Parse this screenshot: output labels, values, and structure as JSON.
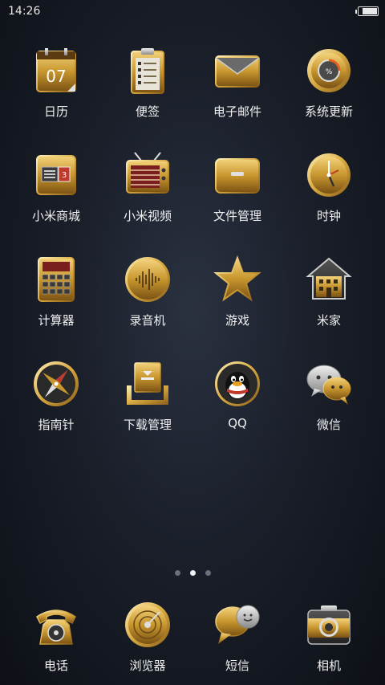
{
  "status": {
    "time": "14:26",
    "battery_level": 0.85
  },
  "apps": [
    {
      "label": "日历",
      "icon": "calendar-icon",
      "date": "07"
    },
    {
      "label": "便签",
      "icon": "notes-icon"
    },
    {
      "label": "电子邮件",
      "icon": "email-icon"
    },
    {
      "label": "系统更新",
      "icon": "system-update-icon"
    },
    {
      "label": "小米商城",
      "icon": "mi-store-icon",
      "badge": "3"
    },
    {
      "label": "小米视频",
      "icon": "tv-video-icon"
    },
    {
      "label": "文件管理",
      "icon": "file-manager-icon"
    },
    {
      "label": "时钟",
      "icon": "clock-icon"
    },
    {
      "label": "计算器",
      "icon": "calculator-icon"
    },
    {
      "label": "录音机",
      "icon": "recorder-icon"
    },
    {
      "label": "游戏",
      "icon": "star-icon"
    },
    {
      "label": "米家",
      "icon": "home-icon"
    },
    {
      "label": "指南针",
      "icon": "compass-icon"
    },
    {
      "label": "下载管理",
      "icon": "download-icon"
    },
    {
      "label": "QQ",
      "icon": "qq-penguin-icon"
    },
    {
      "label": "微信",
      "icon": "wechat-icon"
    }
  ],
  "pager": {
    "pages": 3,
    "current": 2
  },
  "dock": [
    {
      "label": "电话",
      "icon": "phone-icon"
    },
    {
      "label": "浏览器",
      "icon": "browser-icon"
    },
    {
      "label": "短信",
      "icon": "sms-icon"
    },
    {
      "label": "相机",
      "icon": "camera-icon"
    }
  ],
  "colors": {
    "gold": "#c8962e",
    "gold_light": "#e9c46a",
    "dark": "#1a1f2a"
  }
}
